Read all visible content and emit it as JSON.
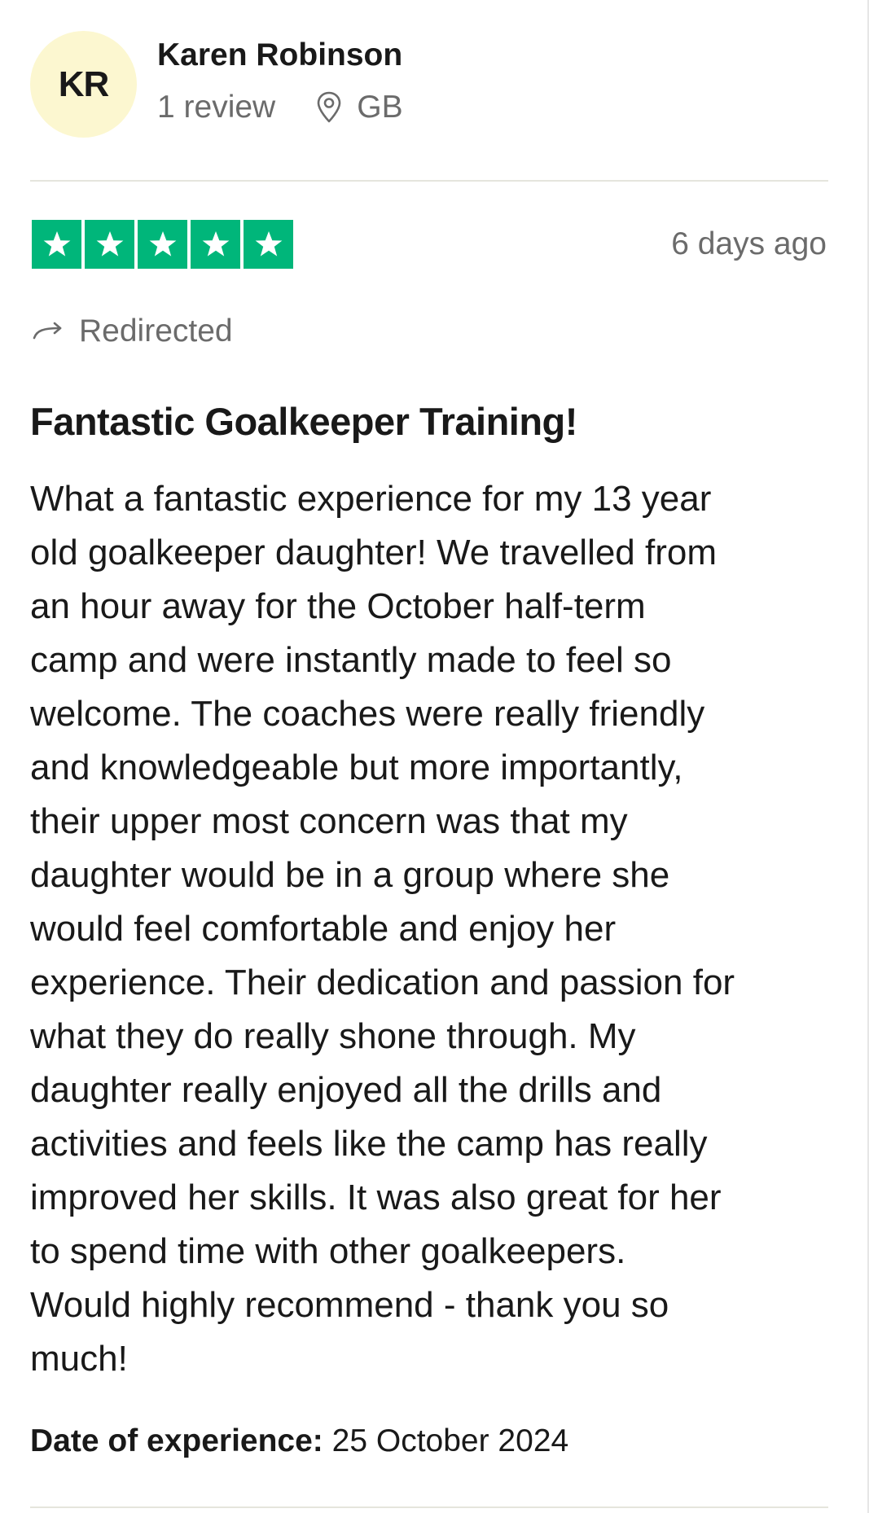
{
  "reviewer": {
    "initials": "KR",
    "name": "Karen Robinson",
    "review_count": "1 review",
    "country": "GB",
    "avatar_color": "#fcf7d0"
  },
  "review": {
    "rating": 5,
    "max_rating": 5,
    "star_color": "#00b67a",
    "posted": "6 days ago",
    "redirected_label": "Redirected",
    "title": "Fantastic Goalkeeper Training!",
    "body_lines": [
      "What a fantastic experience for my 13 year",
      "old goalkeeper daughter! We travelled from",
      "an hour away for the October half-term",
      "camp and were instantly made to feel so",
      "welcome. The coaches were really friendly",
      "and knowledgeable but more importantly,",
      "their upper most concern was that my",
      "daughter would be in a group where she",
      "would feel comfortable and enjoy her",
      "experience. Their dedication and passion for",
      "what they do really shone through. My",
      "daughter really enjoyed all the drills and",
      "activities and feels like the camp has really",
      "improved her skills. It was also great for her",
      "to spend time with other goalkeepers.",
      "Would highly recommend - thank you so",
      "much!"
    ],
    "experience_label": "Date of experience:",
    "experience_date": "25 October 2024"
  },
  "icons": {
    "location": "location-pin-icon",
    "redirect": "redirect-arrow-icon",
    "star": "star-icon"
  }
}
